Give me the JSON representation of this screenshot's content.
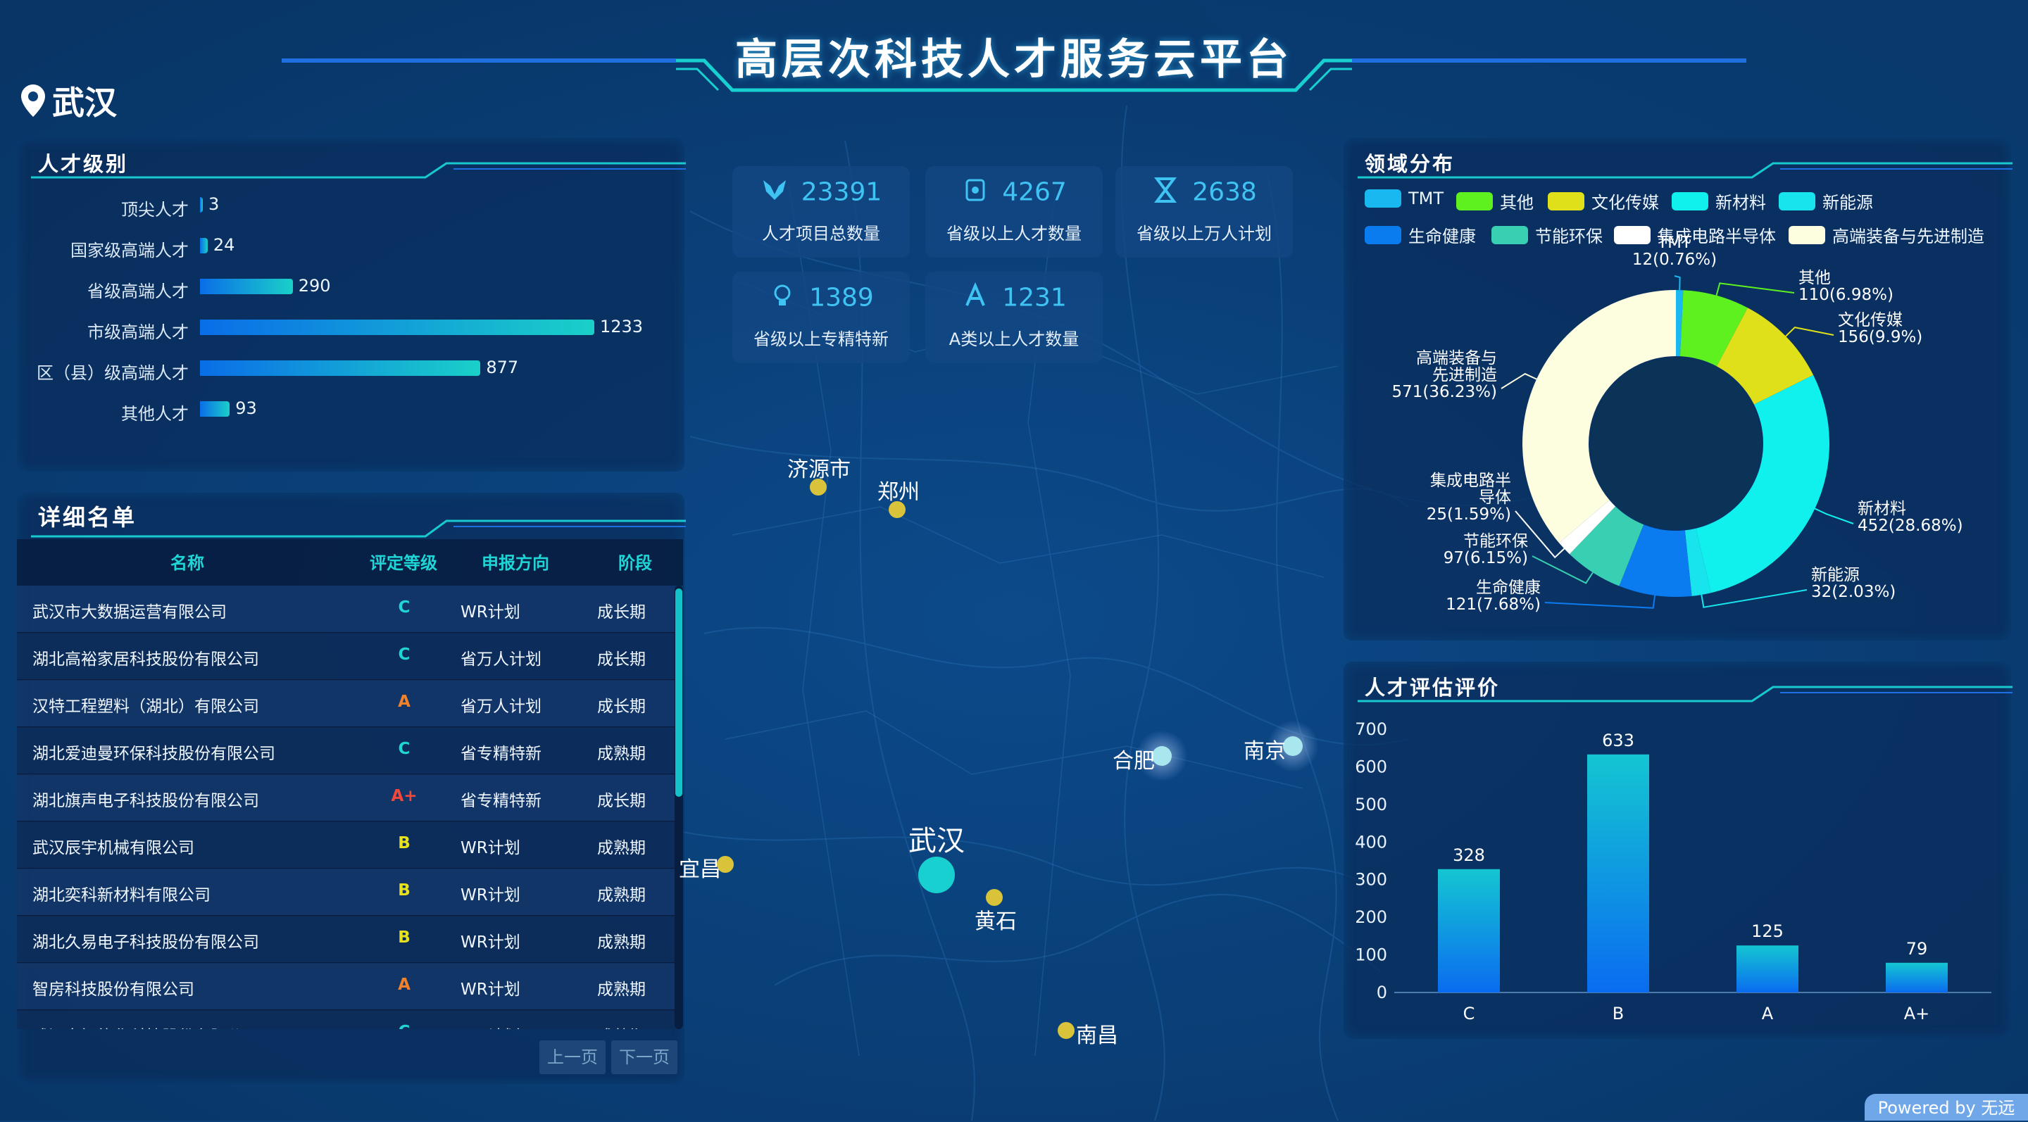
{
  "header": {
    "title": "高层次科技人才服务云平台",
    "city": "武汉"
  },
  "talent_level": {
    "title": "人才级别",
    "items": [
      {
        "label": "顶尖人才",
        "value": 3
      },
      {
        "label": "国家级高端人才",
        "value": 24
      },
      {
        "label": "省级高端人才",
        "value": 290
      },
      {
        "label": "市级高端人才",
        "value": 1233
      },
      {
        "label": "区（县）级高端人才",
        "value": 877
      },
      {
        "label": "其他人才",
        "value": 93
      }
    ]
  },
  "stats": [
    {
      "value": "23391",
      "label": "人才项目总数量",
      "icon": "fox-logo-icon"
    },
    {
      "value": "4267",
      "label": "省级以上人才数量",
      "icon": "badge-icon"
    },
    {
      "value": "2638",
      "label": "省级以上万人计划",
      "icon": "hourglass-icon"
    },
    {
      "value": "1389",
      "label": "省级以上专精特新",
      "icon": "lightbulb-icon"
    },
    {
      "value": "1231",
      "label": "A类以上人才数量",
      "icon": "a-grade-icon"
    }
  ],
  "detail": {
    "title": "详细名单",
    "columns": [
      "名称",
      "评定等级",
      "申报方向",
      "阶段"
    ],
    "rows": [
      [
        "武汉市大数据运营有限公司",
        "C",
        "WR计划",
        "成长期"
      ],
      [
        "湖北高裕家居科技股份有限公司",
        "C",
        "省万人计划",
        "成长期"
      ],
      [
        "汉特工程塑料（湖北）有限公司",
        "A",
        "省万人计划",
        "成长期"
      ],
      [
        "湖北爱迪曼环保科技股份有限公司",
        "C",
        "省专精特新",
        "成熟期"
      ],
      [
        "湖北旗声电子科技股份有限公司",
        "A+",
        "省专精特新",
        "成长期"
      ],
      [
        "武汉辰宇机械有限公司",
        "B",
        "WR计划",
        "成熟期"
      ],
      [
        "湖北奕科新材料有限公司",
        "B",
        "WR计划",
        "成熟期"
      ],
      [
        "湖北久易电子科技股份有限公司",
        "B",
        "WR计划",
        "成熟期"
      ],
      [
        "智房科技股份有限公司",
        "A",
        "WR计划",
        "成熟期"
      ],
      [
        "武汉市智能化科技股份有限公司",
        "C",
        "WR计划",
        "成熟期"
      ]
    ],
    "prev": "上一页",
    "next": "下一页"
  },
  "grade_colors": {
    "C": "#1fd6d6",
    "A": "#f2812b",
    "B": "#e8e21d",
    "A+": "#f2473b"
  },
  "map": {
    "cities": [
      {
        "name": "济源市"
      },
      {
        "name": "郑州"
      },
      {
        "name": "合肥"
      },
      {
        "name": "南京"
      },
      {
        "name": "武汉"
      },
      {
        "name": "宜昌"
      },
      {
        "name": "黄石"
      },
      {
        "name": "南昌"
      }
    ]
  },
  "field_distribution": {
    "title": "领域分布",
    "chart_data": {
      "type": "pie",
      "donut": true,
      "slices": [
        {
          "name": "TMT",
          "value": 12,
          "label": "12(0.76%)",
          "color": "#1ab8f0"
        },
        {
          "name": "其他",
          "value": 110,
          "label": "110(6.98%)",
          "color": "#5ef01f"
        },
        {
          "name": "文化传媒",
          "value": 156,
          "label": "156(9.9%)",
          "color": "#dfe01a"
        },
        {
          "name": "新材料",
          "value": 452,
          "label": "452(28.68%)",
          "color": "#10f0ec"
        },
        {
          "name": "新能源",
          "value": 32,
          "label": "32(2.03%)",
          "color": "#18e4ee"
        },
        {
          "name": "生命健康",
          "value": 121,
          "label": "121(7.68%)",
          "color": "#0b7cf0"
        },
        {
          "name": "节能环保",
          "value": 97,
          "label": "97(6.15%)",
          "color": "#39cfb2"
        },
        {
          "name": "集成电路半导体",
          "value": 25,
          "label": "25(1.59%)",
          "color": "#ffffff"
        },
        {
          "name": "高端装备与先进制造",
          "value": 571,
          "label": "571(36.23%)",
          "color": "#fdfde0"
        }
      ]
    }
  },
  "evaluation": {
    "title": "人才评估评价",
    "chart_data": {
      "type": "bar",
      "categories": [
        "C",
        "B",
        "A",
        "A+"
      ],
      "values": [
        328,
        633,
        125,
        79
      ],
      "ylim": [
        0,
        700
      ],
      "yticks": [
        0,
        100,
        200,
        300,
        400,
        500,
        600,
        700
      ],
      "grid": false
    }
  },
  "footer": {
    "powered": "Powered by 无远"
  }
}
